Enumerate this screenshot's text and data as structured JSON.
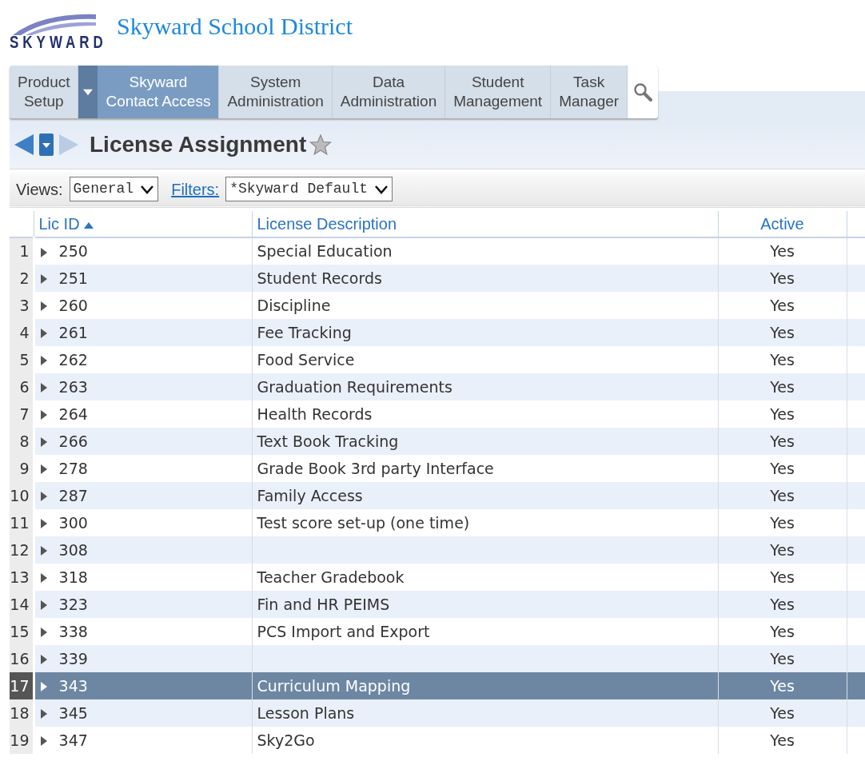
{
  "header": {
    "logo_text": "SKYWARD",
    "district": "Skyward School District"
  },
  "nav": {
    "tabs": [
      {
        "lines": [
          "Product",
          "Setup"
        ],
        "selected": false,
        "dropdown": true
      },
      {
        "lines": [
          "Skyward",
          "Contact Access"
        ],
        "selected": true
      },
      {
        "lines": [
          "System",
          "Administration"
        ],
        "selected": false
      },
      {
        "lines": [
          "Data",
          "Administration"
        ],
        "selected": false
      },
      {
        "lines": [
          "Student",
          "Management"
        ],
        "selected": false
      },
      {
        "lines": [
          "Task",
          "Manager"
        ],
        "selected": false
      }
    ]
  },
  "page_title": "License Assignment",
  "toolbar": {
    "views_label": "Views:",
    "views_value": "General",
    "filters_label": "Filters:",
    "filters_value": "*Skyward Default"
  },
  "table": {
    "columns": [
      {
        "label": "Lic ID",
        "sorted": true
      },
      {
        "label": "License Description",
        "sorted": false
      },
      {
        "label": "Active",
        "sorted": false
      }
    ],
    "rows": [
      {
        "num": "1",
        "lic_id": "250",
        "description": "Special Education",
        "active": "Yes",
        "selected": false
      },
      {
        "num": "2",
        "lic_id": "251",
        "description": "Student Records",
        "active": "Yes",
        "selected": false
      },
      {
        "num": "3",
        "lic_id": "260",
        "description": "Discipline",
        "active": "Yes",
        "selected": false
      },
      {
        "num": "4",
        "lic_id": "261",
        "description": "Fee Tracking",
        "active": "Yes",
        "selected": false
      },
      {
        "num": "5",
        "lic_id": "262",
        "description": "Food Service",
        "active": "Yes",
        "selected": false
      },
      {
        "num": "6",
        "lic_id": "263",
        "description": "Graduation Requirements",
        "active": "Yes",
        "selected": false
      },
      {
        "num": "7",
        "lic_id": "264",
        "description": "Health Records",
        "active": "Yes",
        "selected": false
      },
      {
        "num": "8",
        "lic_id": "266",
        "description": "Text Book Tracking",
        "active": "Yes",
        "selected": false
      },
      {
        "num": "9",
        "lic_id": "278",
        "description": "Grade Book 3rd party Interface",
        "active": "Yes",
        "selected": false
      },
      {
        "num": "10",
        "lic_id": "287",
        "description": "Family Access",
        "active": "Yes",
        "selected": false
      },
      {
        "num": "11",
        "lic_id": "300",
        "description": "Test score set-up (one time)",
        "active": "Yes",
        "selected": false
      },
      {
        "num": "12",
        "lic_id": "308",
        "active": "Yes",
        "selected": false
      },
      {
        "num": "13",
        "lic_id": "318",
        "description": "Teacher Gradebook",
        "active": "Yes",
        "selected": false
      },
      {
        "num": "14",
        "lic_id": "323",
        "description": "Fin and HR PEIMS",
        "active": "Yes",
        "selected": false
      },
      {
        "num": "15",
        "lic_id": "338",
        "description": "PCS Import and Export",
        "active": "Yes",
        "selected": false
      },
      {
        "num": "16",
        "lic_id": "339",
        "active": "Yes",
        "selected": false
      },
      {
        "num": "17",
        "lic_id": "343",
        "description": "Curriculum Mapping",
        "active": "Yes",
        "selected": true
      },
      {
        "num": "18",
        "lic_id": "345",
        "description": "Lesson Plans",
        "active": "Yes",
        "selected": false
      },
      {
        "num": "19",
        "lic_id": "347",
        "description": "Sky2Go",
        "active": "Yes",
        "selected": false
      }
    ]
  }
}
